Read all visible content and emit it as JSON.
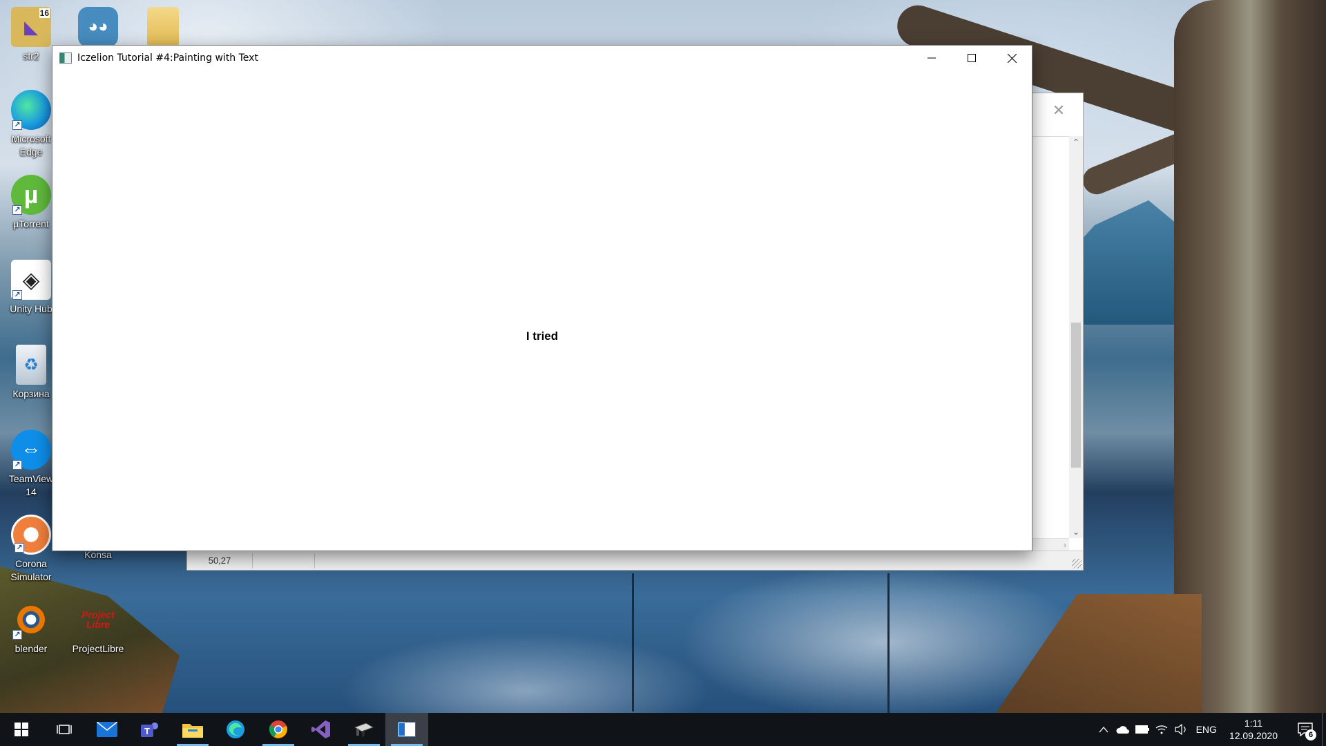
{
  "desktop": {
    "icons": [
      {
        "label": "str2",
        "icon": "visual-studio-file-icon",
        "color": "#d9b85c"
      },
      {
        "label": "",
        "icon": "godot-icon",
        "color": "#478cbf"
      },
      {
        "label": "",
        "icon": "folder-icon",
        "color": "#e8c66a"
      },
      {
        "label": "Microsoft\nEdge",
        "icon": "edge-icon",
        "color": "#1b9de2"
      },
      {
        "label": "µTorrent",
        "icon": "utorrent-icon",
        "color": "#5fba3c"
      },
      {
        "label": "Unity Hub",
        "icon": "unity-hub-icon",
        "color": "#ffffff"
      },
      {
        "label": "Корзина",
        "icon": "recycle-bin-icon",
        "color": "#cfd8e0"
      },
      {
        "label": "TeamView\n14",
        "icon": "teamviewer-icon",
        "color": "#0e8ee9"
      },
      {
        "label": "Corona\nSimulator",
        "icon": "corona-simulator-icon",
        "color": "#f07f3c"
      },
      {
        "label": "Konsa",
        "icon": "konsa-icon",
        "color": "#5a7a4a"
      },
      {
        "label": "blender",
        "icon": "blender-icon",
        "color": "#ea7600"
      },
      {
        "label": "ProjectLibre",
        "icon": "projectlibre-icon",
        "color": "#c91a1a"
      }
    ],
    "projectlibre_overlay": "Project\nLibre"
  },
  "background_window": {
    "close_glyph": "✕",
    "scroll_up": "⌃",
    "scroll_down": "⌄",
    "scroll_right": "›",
    "status_cells": [
      "50,27",
      "",
      ""
    ]
  },
  "window": {
    "title": "Iczelion Tutorial #4:Painting with Text",
    "minimize_glyph": "—",
    "maximize_glyph": "☐",
    "close_glyph": "✕",
    "painted_text": "I tried"
  },
  "taskbar": {
    "apps": [
      {
        "name": "start",
        "icon": "windows-start-icon",
        "running": false,
        "active": false
      },
      {
        "name": "task-view",
        "icon": "task-view-icon",
        "running": false,
        "active": false
      },
      {
        "name": "mail",
        "icon": "mail-icon",
        "running": false,
        "active": false
      },
      {
        "name": "teams",
        "icon": "teams-icon",
        "running": false,
        "active": false
      },
      {
        "name": "file-explorer",
        "icon": "file-explorer-icon",
        "running": true,
        "active": false
      },
      {
        "name": "edge",
        "icon": "edge-icon",
        "running": false,
        "active": false
      },
      {
        "name": "chrome",
        "icon": "chrome-icon",
        "running": true,
        "active": false
      },
      {
        "name": "visual-studio",
        "icon": "visual-studio-icon",
        "running": false,
        "active": false
      },
      {
        "name": "radasm",
        "icon": "radasm-icon",
        "running": true,
        "active": false
      },
      {
        "name": "iczelion-app",
        "icon": "app-window-icon",
        "running": true,
        "active": true
      }
    ],
    "tray": {
      "language": "ENG",
      "time": "1:11",
      "date": "12.09.2020",
      "notification_count": "6"
    }
  },
  "colors": {
    "taskbar_bg": "#101418",
    "running_indicator": "#76b9ed",
    "window_border": "#7a7a7a"
  }
}
